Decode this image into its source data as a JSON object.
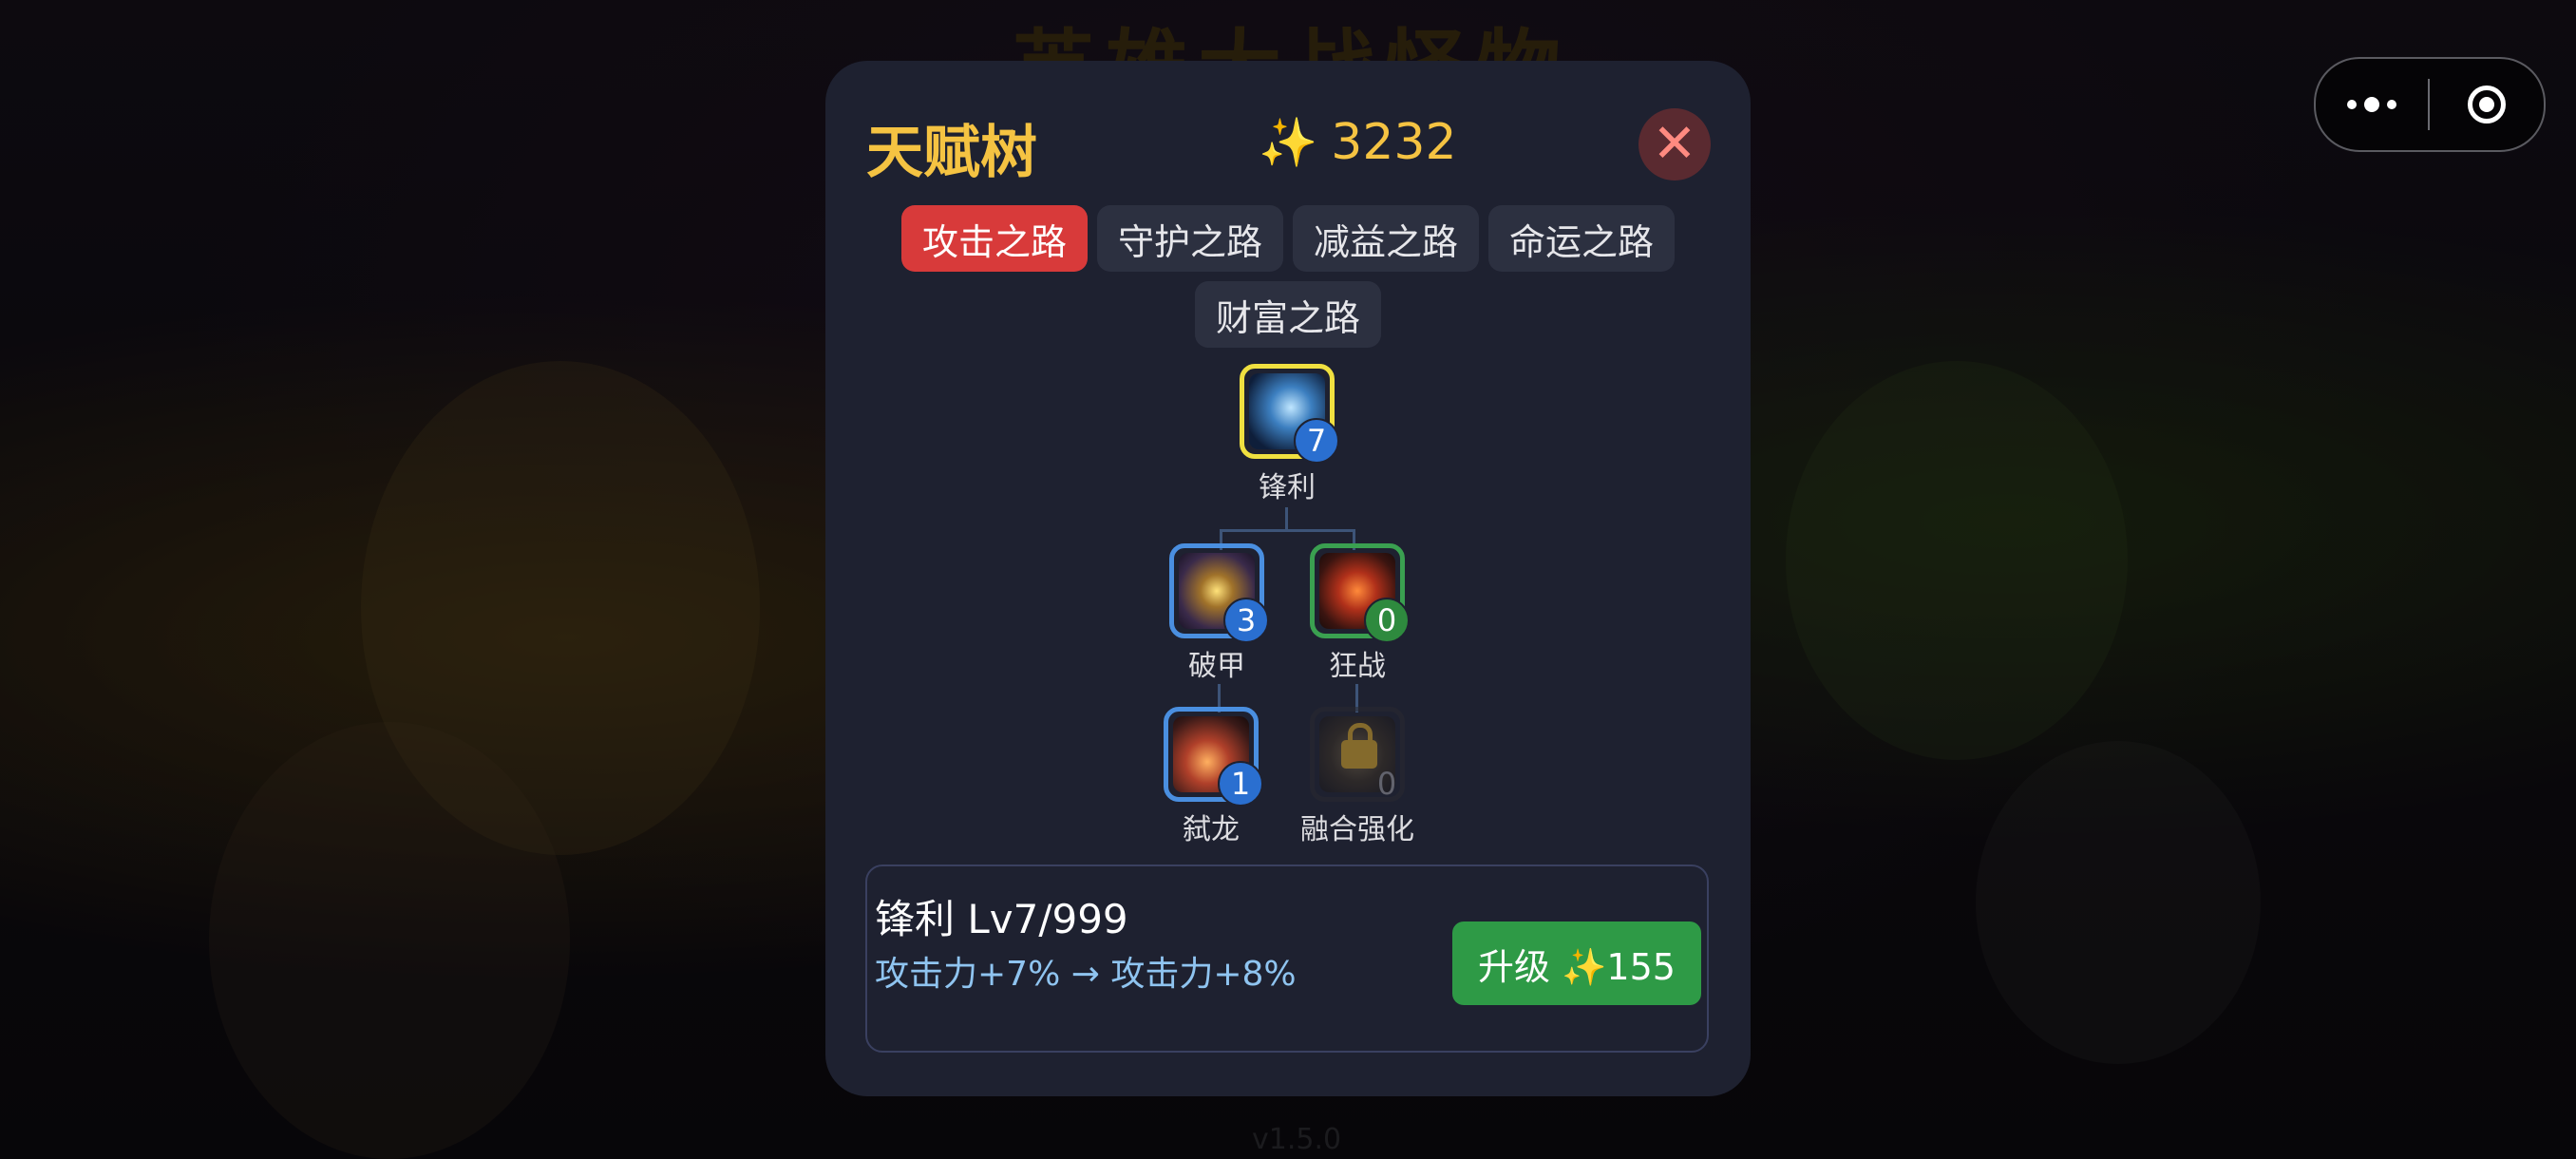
{
  "background": {
    "game_title": "英雄大战怪物",
    "version": "v1.5.0"
  },
  "capsule": {
    "more_icon": "more-dots-icon",
    "close_icon": "target-circle-icon"
  },
  "talent_panel": {
    "title": "天赋树",
    "currency": {
      "icon": "sparkle-icon",
      "value": "3232"
    },
    "close_icon": "close-x-icon",
    "tabs": [
      {
        "label": "攻击之路",
        "active": true
      },
      {
        "label": "守护之路",
        "active": false
      },
      {
        "label": "减益之路",
        "active": false
      },
      {
        "label": "命运之路",
        "active": false
      },
      {
        "label": "财富之路",
        "active": false
      }
    ],
    "nodes": [
      {
        "label": "锋利",
        "level": "7",
        "state": "selected",
        "icon": "ice-sword-icon"
      },
      {
        "label": "破甲",
        "level": "3",
        "state": "unlocked",
        "icon": "armor-break-icon"
      },
      {
        "label": "狂战",
        "level": "0",
        "state": "available",
        "icon": "berserk-icon"
      },
      {
        "label": "弑龙",
        "level": "1",
        "state": "unlocked",
        "icon": "dragon-slayer-icon"
      },
      {
        "label": "融合强化",
        "level": "0",
        "state": "locked",
        "icon": "lock-icon"
      }
    ],
    "detail": {
      "title": "锋利 Lv7/999",
      "effect": "攻击力+7% → 攻击力+8%",
      "upgrade_label": "升级 ✨155"
    }
  },
  "colors": {
    "accent_gold": "#f5c342",
    "tab_active": "#d83a3a",
    "upgrade_green": "#2e9a46",
    "effect_blue": "#8fc4f0"
  }
}
